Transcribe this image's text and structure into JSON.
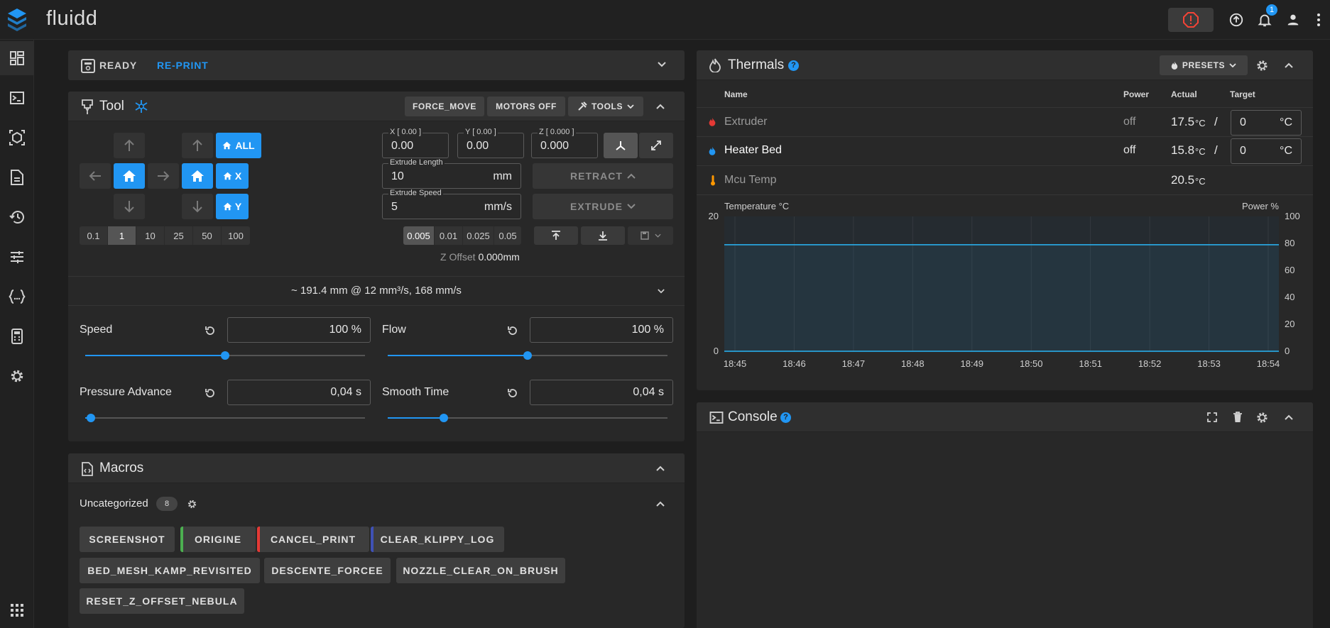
{
  "app": {
    "title": "fluidd",
    "notifications_count": "1"
  },
  "status_card": {
    "state": "READY",
    "reprint": "RE-PRINT"
  },
  "tool_card": {
    "title": "Tool",
    "force_move": "FORCE_MOVE",
    "motors_off": "MOTORS OFF",
    "tools": "TOOLS",
    "home_all": "ALL",
    "home_x": "X",
    "home_y": "Y",
    "step_sizes": [
      "0.1",
      "1",
      "10",
      "25",
      "50",
      "100"
    ],
    "step_selected": "1",
    "pos_x_label": "X [ 0.00 ]",
    "pos_x_value": "0.00",
    "pos_y_label": "Y [ 0.00 ]",
    "pos_y_value": "0.00",
    "pos_z_label": "Z [ 0.000 ]",
    "pos_z_value": "0.000",
    "extrude_length_label": "Extrude Length",
    "extrude_length_value": "10",
    "extrude_length_unit": "mm",
    "extrude_speed_label": "Extrude Speed",
    "extrude_speed_value": "5",
    "extrude_speed_unit": "mm/s",
    "retract": "RETRACT",
    "extrude": "EXTRUDE",
    "z_steps": [
      "0.005",
      "0.01",
      "0.025",
      "0.05"
    ],
    "z_step_selected": "0.005",
    "z_offset_label": "Z Offset",
    "z_offset_value": "0.000mm",
    "extrusion_summary": "~ 191.4 mm @ 12 mm³/s, 168 mm/s",
    "speed_label": "Speed",
    "speed_value": "100 %",
    "speed_fraction": 0.5,
    "flow_label": "Flow",
    "flow_value": "100 %",
    "flow_fraction": 0.5,
    "pa_label": "Pressure Advance",
    "pa_value": "0,04 s",
    "pa_fraction": 0.02,
    "smooth_label": "Smooth Time",
    "smooth_value": "0,04 s",
    "smooth_fraction": 0.2
  },
  "macros_card": {
    "title": "Macros",
    "group_name": "Uncategorized",
    "group_count": "8",
    "buttons": [
      {
        "label": "SCREENSHOT",
        "color": ""
      },
      {
        "label": "ORIGINE",
        "color": "#4caf50"
      },
      {
        "label": "CANCEL_PRINT",
        "color": "#e53935"
      },
      {
        "label": "CLEAR_KLIPPY_LOG",
        "color": "#3f51b5"
      },
      {
        "label": "BED_MESH_KAMP_REVISITED",
        "color": ""
      },
      {
        "label": "DESCENTE_FORCEE",
        "color": ""
      },
      {
        "label": "NOZZLE_CLEAR_ON_BRUSH",
        "color": ""
      },
      {
        "label": "RESET_Z_OFFSET_NEBULA",
        "color": ""
      }
    ]
  },
  "thermals_card": {
    "title": "Thermals",
    "presets": "PRESETS",
    "columns": {
      "name": "Name",
      "power": "Power",
      "actual": "Actual",
      "target": "Target"
    },
    "rows": [
      {
        "name": "Extruder",
        "power": "off",
        "actual": "17.5",
        "unit": "°C",
        "target": "0",
        "target_unit": "°C",
        "icon_color": "#e53935"
      },
      {
        "name": "Heater Bed",
        "power": "off",
        "actual": "15.8",
        "unit": "°C",
        "target": "0",
        "target_unit": "°C",
        "icon_color": "#2196f3"
      },
      {
        "name": "Mcu Temp",
        "power": "",
        "actual": "20.5",
        "unit": "°C",
        "target": "",
        "target_unit": "",
        "icon_color": "#ff9800"
      }
    ],
    "separator": "/"
  },
  "chart_data": {
    "type": "line",
    "ylabel_left": "Temperature °C",
    "ylabel_right": "Power %",
    "x": [
      "18:45",
      "18:46",
      "18:47",
      "18:48",
      "18:49",
      "18:50",
      "18:51",
      "18:52",
      "18:53",
      "18:54"
    ],
    "y_left_ticks": [
      "20",
      "0"
    ],
    "y_right_ticks": [
      "100",
      "80",
      "60",
      "40",
      "20",
      "0"
    ],
    "ylim_left": [
      0,
      20
    ],
    "ylim_right": [
      0,
      100
    ],
    "series": [
      {
        "name": "Heater Bed",
        "color": "#29b6f6",
        "values": [
          15.8,
          15.8,
          15.8,
          15.8,
          15.8,
          15.8,
          15.8,
          15.8,
          15.8,
          15.8
        ]
      },
      {
        "name": "Extruder",
        "color": "#29b6f6",
        "values": [
          0,
          0,
          0,
          0,
          0,
          0,
          0,
          0,
          0,
          0
        ]
      }
    ],
    "grid": true
  },
  "console_card": {
    "title": "Console"
  }
}
